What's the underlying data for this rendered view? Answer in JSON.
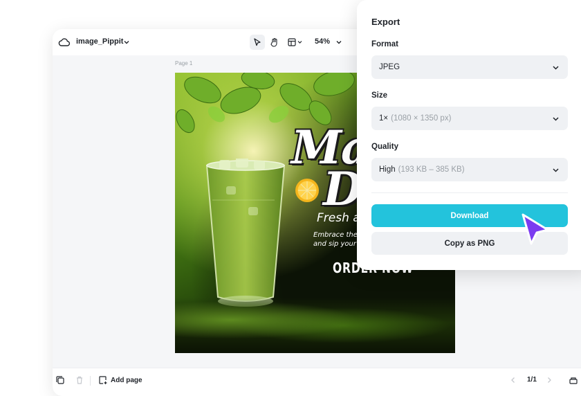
{
  "editor": {
    "project_name": "image_Pippit",
    "zoom": "54%",
    "page_label": "Page 1"
  },
  "artwork": {
    "title_line1": "Ma",
    "title_line2": "Dr",
    "subtitle": "Fresh a",
    "body_line1": "Embrace the",
    "body_line2": "and sip your",
    "cta": "ORDER NOW"
  },
  "bottombar": {
    "add_page_label": "Add page",
    "page_counter": "1/1"
  },
  "export_panel": {
    "title": "Export",
    "format_label": "Format",
    "format_value": "JPEG",
    "size_label": "Size",
    "size_value": "1×",
    "size_hint": "(1080 × 1350 px)",
    "quality_label": "Quality",
    "quality_value": "High",
    "quality_hint": "(193 KB – 385 KB)",
    "download_label": "Download",
    "copy_label": "Copy as PNG"
  },
  "colors": {
    "accent": "#23c3dc",
    "cursor": "#7b3cf0"
  },
  "icons": [
    "cloud-icon",
    "chevron-down-icon",
    "select-pointer-icon",
    "hand-icon",
    "layout-icon",
    "duplicate-icon",
    "trash-icon",
    "add-page-icon",
    "chevron-left-icon",
    "chevron-right-icon",
    "layers-icon",
    "cursor-pointer-icon"
  ]
}
